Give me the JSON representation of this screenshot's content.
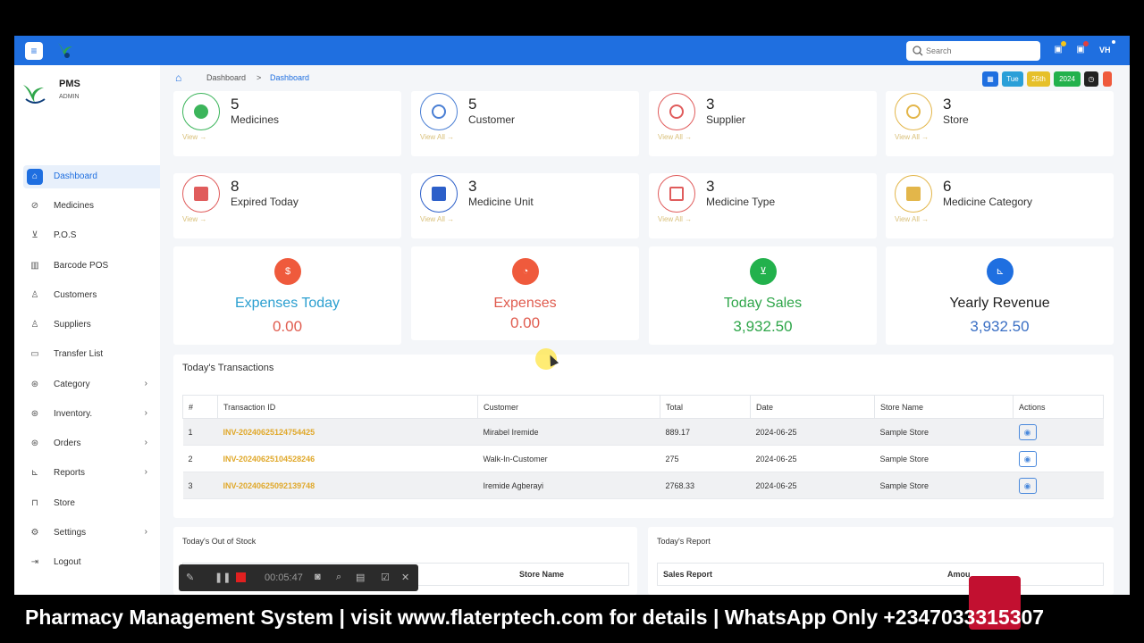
{
  "topbar": {
    "search_placeholder": "Search",
    "avatar_initials": "VH"
  },
  "date_chips": {
    "day": "Tue",
    "date": "25th",
    "year": "2024"
  },
  "brand": {
    "name": "PMS",
    "role": "ADMIN"
  },
  "sidebar": {
    "items": [
      {
        "label": "Dashboard",
        "icon": "home-icon",
        "active": true,
        "has_submenu": false
      },
      {
        "label": "Medicines",
        "icon": "pill-icon",
        "has_submenu": false
      },
      {
        "label": "P.O.S",
        "icon": "cart-icon",
        "has_submenu": false
      },
      {
        "label": "Barcode POS",
        "icon": "barcode-icon",
        "has_submenu": false
      },
      {
        "label": "Customers",
        "icon": "user-icon",
        "has_submenu": false
      },
      {
        "label": "Suppliers",
        "icon": "user-icon",
        "has_submenu": false
      },
      {
        "label": "Transfer List",
        "icon": "map-icon",
        "has_submenu": false
      },
      {
        "label": "Category",
        "icon": "gear-icon",
        "has_submenu": true
      },
      {
        "label": "Inventory.",
        "icon": "gear-icon",
        "has_submenu": true
      },
      {
        "label": "Orders",
        "icon": "gear-icon",
        "has_submenu": true
      },
      {
        "label": "Reports",
        "icon": "chart-icon",
        "has_submenu": true
      },
      {
        "label": "Store",
        "icon": "store-icon",
        "has_submenu": false
      },
      {
        "label": "Settings",
        "icon": "gear-icon",
        "has_submenu": true
      },
      {
        "label": "Logout",
        "icon": "logout-icon",
        "has_submenu": false
      }
    ]
  },
  "breadcrumb": {
    "root": "Dashboard",
    "sep": ">",
    "current": "Dashboard"
  },
  "stats": [
    {
      "value": "5",
      "label": "Medicines",
      "link": "View",
      "color": "#3cb55b"
    },
    {
      "value": "5",
      "label": "Customer",
      "link": "View All",
      "color": "#4a7fd4"
    },
    {
      "value": "3",
      "label": "Supplier",
      "link": "View All",
      "color": "#e05c5c"
    },
    {
      "value": "3",
      "label": "Store",
      "link": "View All",
      "color": "#e3b64a"
    },
    {
      "value": "8",
      "label": "Expired Today",
      "link": "View",
      "color": "#e05c5c"
    },
    {
      "value": "3",
      "label": "Medicine Unit",
      "link": "View All",
      "color": "#2c5fc9"
    },
    {
      "value": "3",
      "label": "Medicine Type",
      "link": "View All",
      "color": "#e05c5c"
    },
    {
      "value": "6",
      "label": "Medicine Category",
      "link": "View All",
      "color": "#e3b64a"
    }
  ],
  "finance": [
    {
      "label": "Expenses Today",
      "value": "0.00",
      "label_color": "#2b9fd0",
      "value_color": "#e05c4f",
      "icon_color": "#ef5a3c",
      "icon": "dollar-icon"
    },
    {
      "label": "Expenses",
      "value": "0.00",
      "label_color": "#e05c4f",
      "value_color": "#e05c4f",
      "icon_color": "#ef5a3c",
      "icon": "pie-chart-icon"
    },
    {
      "label": "Today Sales",
      "value": "3,932.50",
      "label_color": "#2fa64a",
      "value_color": "#2fa64a",
      "icon_color": "#22b14c",
      "icon": "cart-icon"
    },
    {
      "label": "Yearly Revenue",
      "value": "3,932.50",
      "label_color": "#222222",
      "value_color": "#3a6fc4",
      "icon_color": "#1f6fe0",
      "icon": "chart-icon"
    }
  ],
  "transactions": {
    "title": "Today's Transactions",
    "headers": [
      "#",
      "Transaction ID",
      "Customer",
      "Total",
      "Date",
      "Store Name",
      "Actions"
    ],
    "rows": [
      {
        "n": "1",
        "id": "INV-20240625124754425",
        "customer": "Mirabel Iremide",
        "total": "889.17",
        "date": "2024-06-25",
        "store": "Sample Store"
      },
      {
        "n": "2",
        "id": "INV-20240625104528246",
        "customer": "Walk-In-Customer",
        "total": "275",
        "date": "2024-06-25",
        "store": "Sample Store"
      },
      {
        "n": "3",
        "id": "INV-20240625092139748",
        "customer": "Iremide Agberayi",
        "total": "2768.33",
        "date": "2024-06-25",
        "store": "Sample Store"
      }
    ]
  },
  "out_of_stock": {
    "title": "Today's Out of Stock",
    "col_store": "Store Name"
  },
  "report": {
    "title": "Today's Report",
    "col_sales": "Sales Report",
    "col_amount": "Amou"
  },
  "recorder": {
    "time": "00:05:47"
  },
  "caption": "Pharmacy Management System  | visit www.flaterptech.com for details | WhatsApp Only +2347033315307"
}
